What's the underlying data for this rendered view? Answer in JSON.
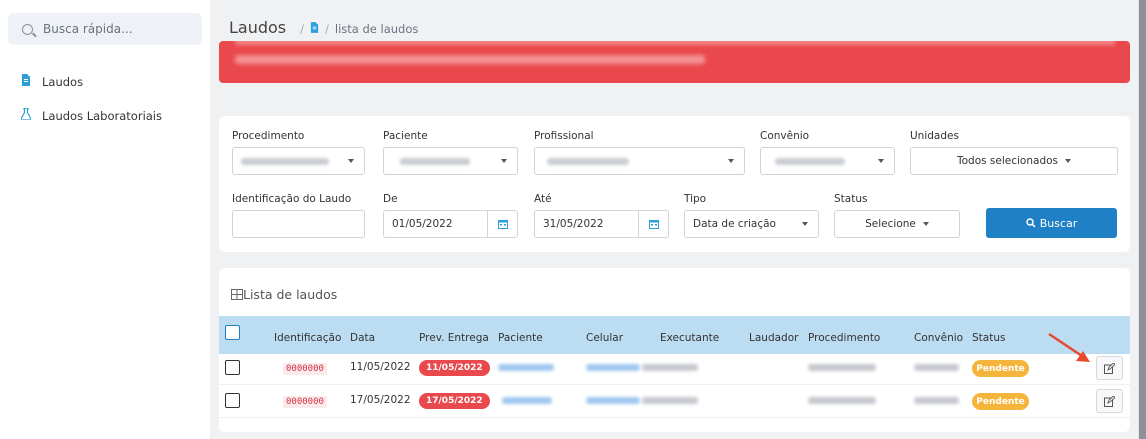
{
  "sidebar": {
    "search_placeholder": "Busca rápida...",
    "items": [
      {
        "label": "Laudos",
        "icon": "document-icon"
      },
      {
        "label": "Laudos Laboratoriais",
        "icon": "flask-icon"
      }
    ]
  },
  "breadcrumb": {
    "title": "Laudos",
    "current": "lista de laudos"
  },
  "filters": {
    "procedimento_label": "Procedimento",
    "paciente_label": "Paciente",
    "profissional_label": "Profissional",
    "convenio_label": "Convênio",
    "unidades_label": "Unidades",
    "unidades_value": "Todos selecionados",
    "identificacao_label": "Identificação do Laudo",
    "de_label": "De",
    "de_value": "01/05/2022",
    "ate_label": "Até",
    "ate_value": "31/05/2022",
    "tipo_label": "Tipo",
    "tipo_value": "Data de criação",
    "status_label": "Status",
    "status_value": "Selecione",
    "buscar_label": "Buscar"
  },
  "lista": {
    "title": "Lista de laudos",
    "columns": [
      "Identificação",
      "Data",
      "Prev. Entrega",
      "Paciente",
      "Celular",
      "Executante",
      "Laudador",
      "Procedimento",
      "Convênio",
      "Status"
    ],
    "rows": [
      {
        "id": "0000000",
        "data": "11/05/2022",
        "prev_entrega": "11/05/2022",
        "status": "Pendente"
      },
      {
        "id": "0000000",
        "data": "17/05/2022",
        "prev_entrega": "17/05/2022",
        "status": "Pendente"
      }
    ]
  },
  "colors": {
    "accent": "#1f80c6",
    "alert": "#e9484c",
    "pending": "#f5b53b",
    "header_row": "#bcdcf1"
  }
}
